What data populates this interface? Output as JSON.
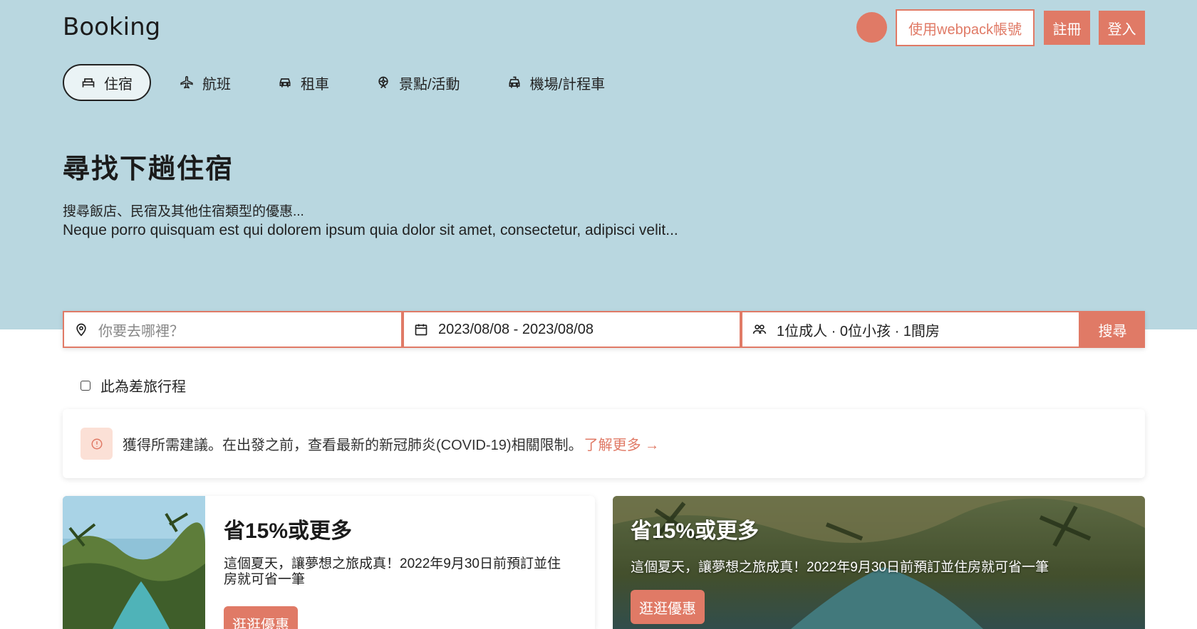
{
  "brand": "Booking",
  "header": {
    "webpack_label": "使用webpack帳號",
    "register_label": "註冊",
    "login_label": "登入"
  },
  "nav": {
    "items": [
      {
        "label": "住宿",
        "icon": "bed-icon",
        "active": true
      },
      {
        "label": "航班",
        "icon": "plane-icon",
        "active": false
      },
      {
        "label": "租車",
        "icon": "car-icon",
        "active": false
      },
      {
        "label": "景點/活動",
        "icon": "ferris-wheel-icon",
        "active": false
      },
      {
        "label": "機場/計程車",
        "icon": "taxi-icon",
        "active": false
      }
    ]
  },
  "hero": {
    "title": "尋找下趟住宿",
    "subtitle": "搜尋飯店、民宿及其他住宿類型的優惠...",
    "lorem": "Neque porro quisquam est qui dolorem ipsum quia dolor sit amet, consectetur, adipisci velit..."
  },
  "search": {
    "destination_placeholder": "你要去哪裡？",
    "dates": "2023/08/08 - 2023/08/08",
    "guests": "1位成人 · 0位小孩 · 1間房",
    "button_label": "搜尋"
  },
  "business_trip": {
    "label": "此為差旅行程",
    "checked": false
  },
  "notice": {
    "text": "獲得所需建議。在出發之前，查看最新的新冠肺炎(COVID-19)相關限制。",
    "link": "了解更多 →"
  },
  "cards": [
    {
      "title": "省15%或更多",
      "description": "這個夏天，讓夢想之旅成真！2022年9月30日前預訂並住房就可省一筆",
      "button_label": "逛逛優惠"
    },
    {
      "title": "省15%或更多",
      "description": "這個夏天，讓夢想之旅成真！2022年9月30日前預訂並住房就可省一筆",
      "button_label": "逛逛優惠"
    }
  ],
  "colors": {
    "accent": "#e07a66",
    "hero_bg": "#b9d7e0",
    "notice_icon_bg": "#fbe0d6"
  }
}
